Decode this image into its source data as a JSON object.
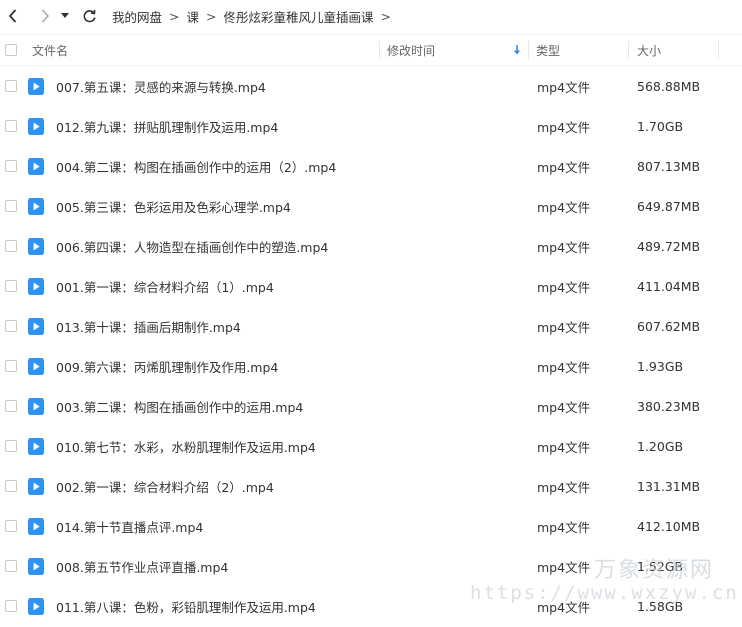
{
  "nav": {
    "back_icon": "chevron-left-icon",
    "forward_icon": "chevron-right-icon",
    "history_icon": "caret-down-icon",
    "refresh_icon": "refresh-icon"
  },
  "breadcrumb": {
    "root": "我的网盘",
    "items": [
      "课",
      "佟彤炫彩童稚风儿童插画课"
    ],
    "separator": ">"
  },
  "columns": {
    "name": "文件名",
    "modified": "修改时间",
    "type": "类型",
    "size": "大小",
    "sort_icon": "sort-down-arrow-icon"
  },
  "files": [
    {
      "name": "007.第五课：灵感的来源与转换.mp4",
      "type": "mp4文件",
      "size": "568.88MB"
    },
    {
      "name": "012.第九课：拼贴肌理制作及运用.mp4",
      "type": "mp4文件",
      "size": "1.70GB"
    },
    {
      "name": "004.第二课：构图在插画创作中的运用（2）.mp4",
      "type": "mp4文件",
      "size": "807.13MB"
    },
    {
      "name": "005.第三课：色彩运用及色彩心理学.mp4",
      "type": "mp4文件",
      "size": "649.87MB"
    },
    {
      "name": "006.第四课：人物造型在插画创作中的塑造.mp4",
      "type": "mp4文件",
      "size": "489.72MB"
    },
    {
      "name": "001.第一课：综合材料介绍（1）.mp4",
      "type": "mp4文件",
      "size": "411.04MB"
    },
    {
      "name": "013.第十课：插画后期制作.mp4",
      "type": "mp4文件",
      "size": "607.62MB"
    },
    {
      "name": "009.第六课：丙烯肌理制作及作用.mp4",
      "type": "mp4文件",
      "size": "1.93GB"
    },
    {
      "name": "003.第二课：构图在插画创作中的运用.mp4",
      "type": "mp4文件",
      "size": "380.23MB"
    },
    {
      "name": "010.第七节：水彩，水粉肌理制作及运用.mp4",
      "type": "mp4文件",
      "size": "1.20GB"
    },
    {
      "name": "002.第一课：综合材料介绍（2）.mp4",
      "type": "mp4文件",
      "size": "131.31MB"
    },
    {
      "name": "014.第十节直播点评.mp4",
      "type": "mp4文件",
      "size": "412.10MB"
    },
    {
      "name": "008.第五节作业点评直播.mp4",
      "type": "mp4文件",
      "size": "1.52GB"
    },
    {
      "name": "011.第八课：色粉，彩铅肌理制作及运用.mp4",
      "type": "mp4文件",
      "size": "1.58GB"
    }
  ],
  "watermark": {
    "brand": "万象资源网",
    "url": "https://www.wxzyw.cn"
  },
  "colors": {
    "file_icon": "#2e93f3",
    "text": "#333333",
    "header_text": "#666666",
    "sort_arrow": "#2e8ef0",
    "watermark": "#cdd3da"
  }
}
